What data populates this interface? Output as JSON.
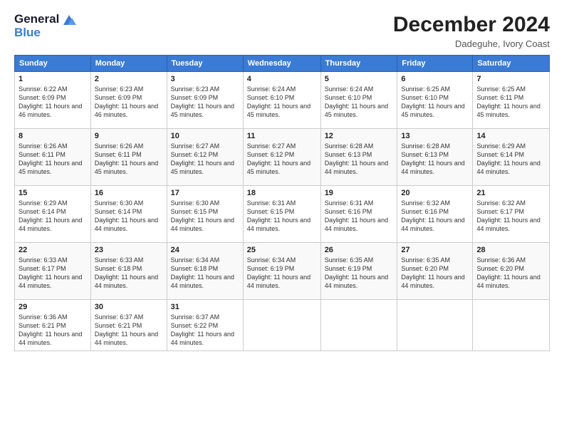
{
  "header": {
    "logo_line1": "General",
    "logo_line2": "Blue",
    "month_title": "December 2024",
    "location": "Dadeguhe, Ivory Coast"
  },
  "days_of_week": [
    "Sunday",
    "Monday",
    "Tuesday",
    "Wednesday",
    "Thursday",
    "Friday",
    "Saturday"
  ],
  "weeks": [
    [
      {
        "day": "1",
        "info": "Sunrise: 6:22 AM\nSunset: 6:09 PM\nDaylight: 11 hours and 46 minutes."
      },
      {
        "day": "2",
        "info": "Sunrise: 6:23 AM\nSunset: 6:09 PM\nDaylight: 11 hours and 46 minutes."
      },
      {
        "day": "3",
        "info": "Sunrise: 6:23 AM\nSunset: 6:09 PM\nDaylight: 11 hours and 45 minutes."
      },
      {
        "day": "4",
        "info": "Sunrise: 6:24 AM\nSunset: 6:10 PM\nDaylight: 11 hours and 45 minutes."
      },
      {
        "day": "5",
        "info": "Sunrise: 6:24 AM\nSunset: 6:10 PM\nDaylight: 11 hours and 45 minutes."
      },
      {
        "day": "6",
        "info": "Sunrise: 6:25 AM\nSunset: 6:10 PM\nDaylight: 11 hours and 45 minutes."
      },
      {
        "day": "7",
        "info": "Sunrise: 6:25 AM\nSunset: 6:11 PM\nDaylight: 11 hours and 45 minutes."
      }
    ],
    [
      {
        "day": "8",
        "info": "Sunrise: 6:26 AM\nSunset: 6:11 PM\nDaylight: 11 hours and 45 minutes."
      },
      {
        "day": "9",
        "info": "Sunrise: 6:26 AM\nSunset: 6:11 PM\nDaylight: 11 hours and 45 minutes."
      },
      {
        "day": "10",
        "info": "Sunrise: 6:27 AM\nSunset: 6:12 PM\nDaylight: 11 hours and 45 minutes."
      },
      {
        "day": "11",
        "info": "Sunrise: 6:27 AM\nSunset: 6:12 PM\nDaylight: 11 hours and 45 minutes."
      },
      {
        "day": "12",
        "info": "Sunrise: 6:28 AM\nSunset: 6:13 PM\nDaylight: 11 hours and 44 minutes."
      },
      {
        "day": "13",
        "info": "Sunrise: 6:28 AM\nSunset: 6:13 PM\nDaylight: 11 hours and 44 minutes."
      },
      {
        "day": "14",
        "info": "Sunrise: 6:29 AM\nSunset: 6:14 PM\nDaylight: 11 hours and 44 minutes."
      }
    ],
    [
      {
        "day": "15",
        "info": "Sunrise: 6:29 AM\nSunset: 6:14 PM\nDaylight: 11 hours and 44 minutes."
      },
      {
        "day": "16",
        "info": "Sunrise: 6:30 AM\nSunset: 6:14 PM\nDaylight: 11 hours and 44 minutes."
      },
      {
        "day": "17",
        "info": "Sunrise: 6:30 AM\nSunset: 6:15 PM\nDaylight: 11 hours and 44 minutes."
      },
      {
        "day": "18",
        "info": "Sunrise: 6:31 AM\nSunset: 6:15 PM\nDaylight: 11 hours and 44 minutes."
      },
      {
        "day": "19",
        "info": "Sunrise: 6:31 AM\nSunset: 6:16 PM\nDaylight: 11 hours and 44 minutes."
      },
      {
        "day": "20",
        "info": "Sunrise: 6:32 AM\nSunset: 6:16 PM\nDaylight: 11 hours and 44 minutes."
      },
      {
        "day": "21",
        "info": "Sunrise: 6:32 AM\nSunset: 6:17 PM\nDaylight: 11 hours and 44 minutes."
      }
    ],
    [
      {
        "day": "22",
        "info": "Sunrise: 6:33 AM\nSunset: 6:17 PM\nDaylight: 11 hours and 44 minutes."
      },
      {
        "day": "23",
        "info": "Sunrise: 6:33 AM\nSunset: 6:18 PM\nDaylight: 11 hours and 44 minutes."
      },
      {
        "day": "24",
        "info": "Sunrise: 6:34 AM\nSunset: 6:18 PM\nDaylight: 11 hours and 44 minutes."
      },
      {
        "day": "25",
        "info": "Sunrise: 6:34 AM\nSunset: 6:19 PM\nDaylight: 11 hours and 44 minutes."
      },
      {
        "day": "26",
        "info": "Sunrise: 6:35 AM\nSunset: 6:19 PM\nDaylight: 11 hours and 44 minutes."
      },
      {
        "day": "27",
        "info": "Sunrise: 6:35 AM\nSunset: 6:20 PM\nDaylight: 11 hours and 44 minutes."
      },
      {
        "day": "28",
        "info": "Sunrise: 6:36 AM\nSunset: 6:20 PM\nDaylight: 11 hours and 44 minutes."
      }
    ],
    [
      {
        "day": "29",
        "info": "Sunrise: 6:36 AM\nSunset: 6:21 PM\nDaylight: 11 hours and 44 minutes."
      },
      {
        "day": "30",
        "info": "Sunrise: 6:37 AM\nSunset: 6:21 PM\nDaylight: 11 hours and 44 minutes."
      },
      {
        "day": "31",
        "info": "Sunrise: 6:37 AM\nSunset: 6:22 PM\nDaylight: 11 hours and 44 minutes."
      },
      null,
      null,
      null,
      null
    ]
  ]
}
